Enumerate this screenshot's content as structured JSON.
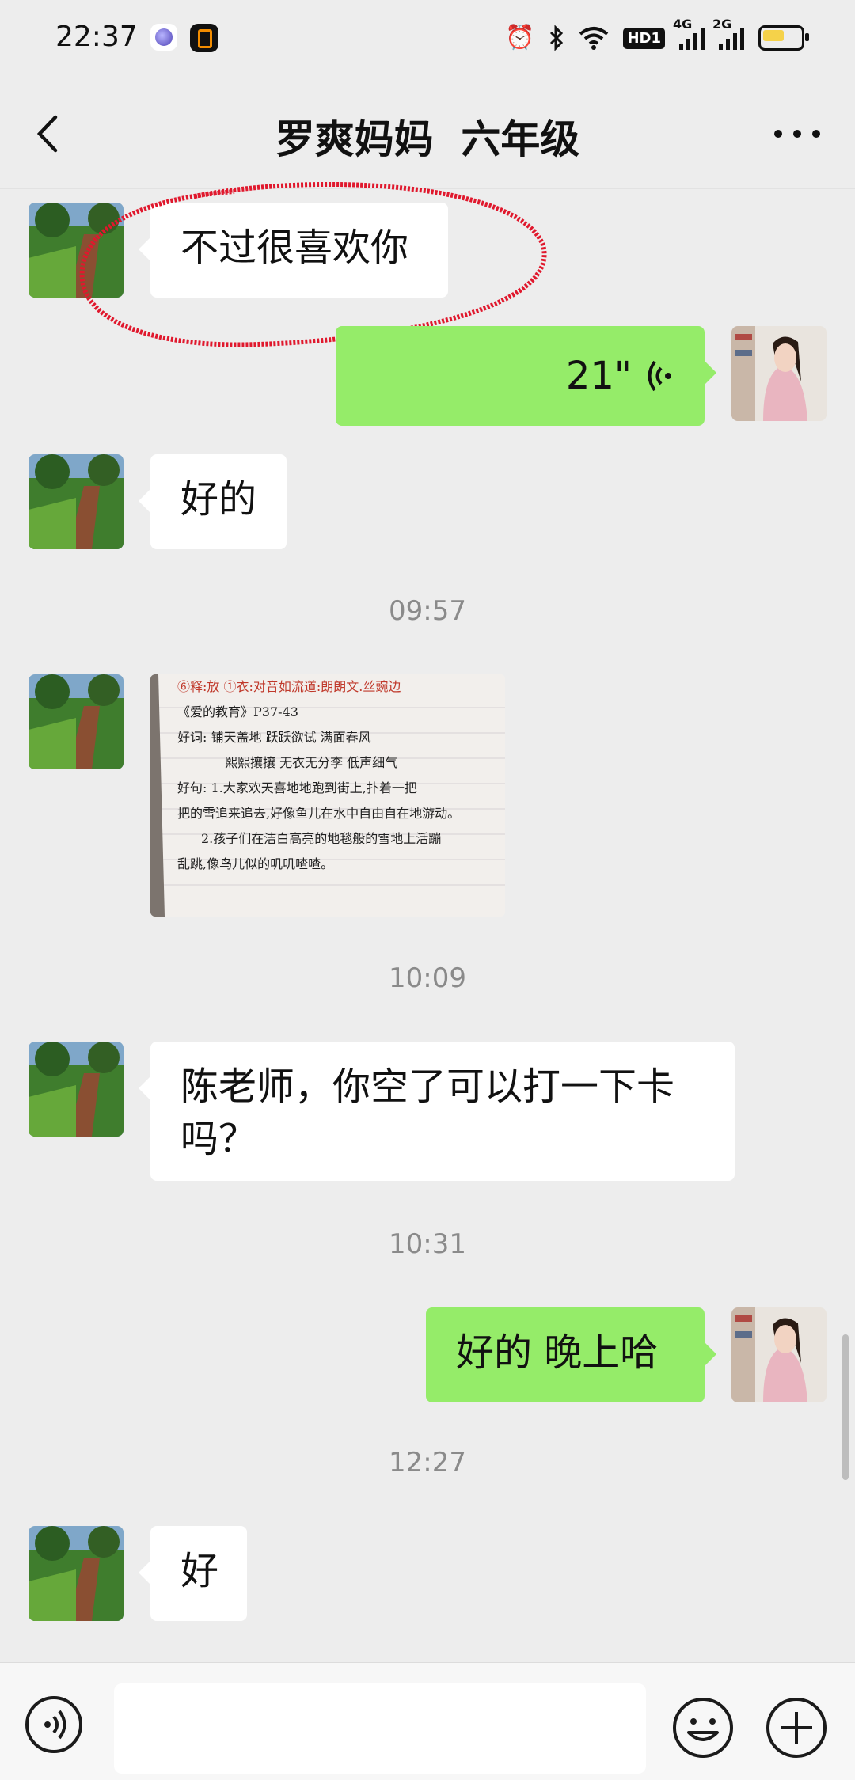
{
  "status_bar": {
    "time": "22:37",
    "hd_label": "HD1",
    "net1": "4G",
    "net2": "2G"
  },
  "header": {
    "title": "罗爽妈妈  六年级"
  },
  "messages": [
    {
      "side": "left",
      "type": "text",
      "text": "不过很喜欢你",
      "annotated_circle": true
    },
    {
      "side": "right",
      "type": "voice",
      "duration": "21\""
    },
    {
      "side": "left",
      "type": "text",
      "text": "好的"
    },
    {
      "type": "time",
      "text": "09:57"
    },
    {
      "side": "left",
      "type": "image",
      "image_lines": [
        "⑥释:放  ①衣:对音如流道:朗朗文.丝豌边",
        "《爱的教育》P37-43",
        "好词: 铺天盖地  跃跃欲试  满面春风",
        "熙熙攘攘  无衣无分李  低声细气",
        "好句: 1.大家欢天喜地地跑到街上,扑着一把",
        "把的雪追来追去,好像鱼儿在水中自由自在地游动。",
        "2.孩子们在洁白高亮的地毯般的雪地上活蹦",
        "乱跳,像鸟儿似的叽叽喳喳。"
      ]
    },
    {
      "type": "time",
      "text": "10:09"
    },
    {
      "side": "left",
      "type": "text",
      "text": "陈老师，你空了可以打一下卡吗？"
    },
    {
      "type": "time",
      "text": "10:31"
    },
    {
      "side": "right",
      "type": "text",
      "text": "好的  晚上哈"
    },
    {
      "type": "time",
      "text": "12:27"
    },
    {
      "side": "left",
      "type": "text",
      "text": "好"
    }
  ],
  "icons": {
    "back": "back-arrow-icon",
    "more": "more-dots-icon",
    "voice_input": "voice-input-icon",
    "emoji": "emoji-icon",
    "add": "plus-icon"
  },
  "colors": {
    "background": "#ededed",
    "bubble_self": "#95ec69",
    "bubble_other": "#ffffff",
    "annotation": "#e0182d"
  }
}
